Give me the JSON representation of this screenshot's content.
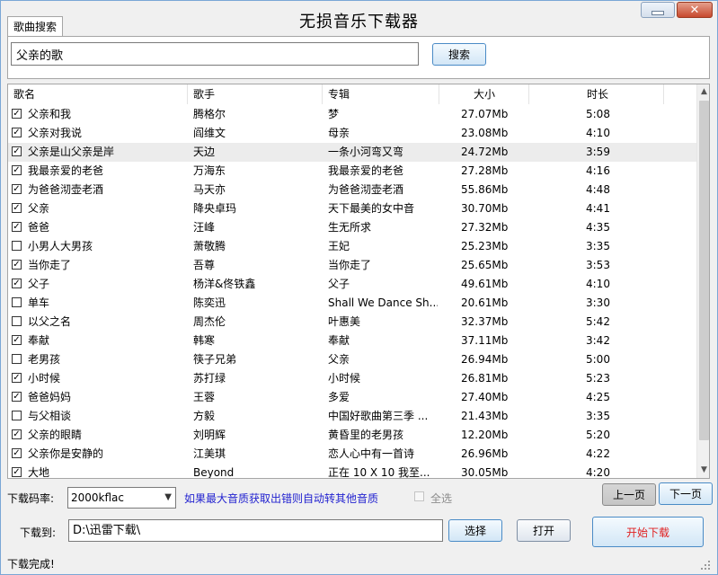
{
  "window": {
    "title": "无损音乐下载器",
    "close_symbol": "✕"
  },
  "search": {
    "tab_label": "歌曲搜索",
    "query": "父亲的歌",
    "button_label": "搜索"
  },
  "list": {
    "columns": [
      "歌名",
      "歌手",
      "专辑",
      "大小",
      "时长"
    ],
    "selected_row": 2,
    "rows": [
      {
        "checked": true,
        "title": "父亲和我",
        "artist": "腾格尔",
        "album": "梦",
        "size": "27.07Mb",
        "duration": "5:08"
      },
      {
        "checked": true,
        "title": "父亲对我说",
        "artist": "阎维文",
        "album": "母亲",
        "size": "23.08Mb",
        "duration": "4:10"
      },
      {
        "checked": true,
        "title": "父亲是山父亲是岸",
        "artist": "天边",
        "album": "一条小河弯又弯",
        "size": "24.72Mb",
        "duration": "3:59"
      },
      {
        "checked": true,
        "title": "我最亲爱的老爸",
        "artist": "万海东",
        "album": "我最亲爱的老爸",
        "size": "27.28Mb",
        "duration": "4:16"
      },
      {
        "checked": true,
        "title": "为爸爸沏壶老酒",
        "artist": "马天亦",
        "album": "为爸爸沏壶老酒",
        "size": "55.86Mb",
        "duration": "4:48"
      },
      {
        "checked": true,
        "title": "父亲",
        "artist": "降央卓玛",
        "album": "天下最美的女中音",
        "size": "30.70Mb",
        "duration": "4:41"
      },
      {
        "checked": true,
        "title": "爸爸",
        "artist": "汪峰",
        "album": "生无所求",
        "size": "27.32Mb",
        "duration": "4:35"
      },
      {
        "checked": false,
        "title": "小男人大男孩",
        "artist": "萧敬腾",
        "album": "王妃",
        "size": "25.23Mb",
        "duration": "3:35"
      },
      {
        "checked": true,
        "title": "当你走了",
        "artist": "吾尊",
        "album": "当你走了",
        "size": "25.65Mb",
        "duration": "3:53"
      },
      {
        "checked": true,
        "title": "父子",
        "artist": "杨洋&佟铁鑫",
        "album": "父子",
        "size": "49.61Mb",
        "duration": "4:10"
      },
      {
        "checked": false,
        "title": "单车",
        "artist": "陈奕迅",
        "album": "Shall We Dance Sh...",
        "size": "20.61Mb",
        "duration": "3:30"
      },
      {
        "checked": false,
        "title": "以父之名",
        "artist": "周杰伦",
        "album": "叶惠美",
        "size": "32.37Mb",
        "duration": "5:42"
      },
      {
        "checked": true,
        "title": "奉献",
        "artist": "韩寒",
        "album": "奉献",
        "size": "37.11Mb",
        "duration": "3:42"
      },
      {
        "checked": false,
        "title": "老男孩",
        "artist": "筷子兄弟",
        "album": "父亲",
        "size": "26.94Mb",
        "duration": "5:00"
      },
      {
        "checked": true,
        "title": "小时候",
        "artist": "苏打绿",
        "album": "小时候",
        "size": "26.81Mb",
        "duration": "5:23"
      },
      {
        "checked": true,
        "title": "爸爸妈妈",
        "artist": "王蓉",
        "album": "多爱",
        "size": "27.40Mb",
        "duration": "4:25"
      },
      {
        "checked": false,
        "title": "与父相谈",
        "artist": "方毅",
        "album": "中国好歌曲第三季 ...",
        "size": "21.43Mb",
        "duration": "3:35"
      },
      {
        "checked": true,
        "title": "父亲的眼睛",
        "artist": "刘明辉",
        "album": "黄昏里的老男孩",
        "size": "12.20Mb",
        "duration": "5:20"
      },
      {
        "checked": true,
        "title": "父亲你是安静的",
        "artist": "江美琪",
        "album": "恋人心中有一首诗",
        "size": "26.96Mb",
        "duration": "4:22"
      },
      {
        "checked": true,
        "title": "大地",
        "artist": "Beyond",
        "album": "正在 10 X 10 我至...",
        "size": "30.05Mb",
        "duration": "4:20"
      }
    ]
  },
  "bottom": {
    "bitrate_label": "下载码率:",
    "bitrate_value": "2000kflac",
    "fallback_note": "如果最大音质获取出错则自动转其他音质",
    "select_all_label": "全选",
    "prev_label": "上一页",
    "next_label": "下一页",
    "saveto_label": "下载到:",
    "save_path": "D:\\迅雷下载\\",
    "choose_label": "选择",
    "open_label": "打开",
    "start_label": "开始下载"
  },
  "status": {
    "text": "下载完成!"
  },
  "colors": {
    "accent_blue": "#2323d0",
    "start_red": "#e02020",
    "selected_row_bg": "#ececec"
  }
}
